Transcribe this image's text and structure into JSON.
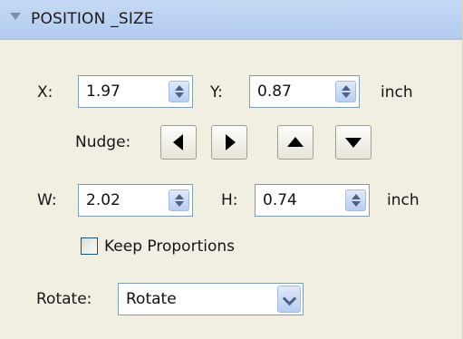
{
  "panel": {
    "title": "POSITION _SIZE"
  },
  "position": {
    "x_label": "X:",
    "x_value": "1.97",
    "y_label": "Y:",
    "y_value": "0.87",
    "unit": "inch"
  },
  "nudge": {
    "label": "Nudge:",
    "buttons": [
      "left-arrow-icon",
      "right-arrow-icon",
      "up-arrow-icon",
      "down-arrow-icon"
    ]
  },
  "size": {
    "w_label": "W:",
    "w_value": "2.02",
    "h_label": "H:",
    "h_value": "0.74",
    "unit": "inch"
  },
  "keep_proportions": {
    "label": "Keep Proportions",
    "checked": false
  },
  "rotate": {
    "label": "Rotate:",
    "selected": "Rotate"
  },
  "colors": {
    "header_bg": "#b9cff1",
    "panel_bg": "#f1efe2",
    "field_border": "#7f9db9",
    "spin_button": "#c9daf6"
  }
}
